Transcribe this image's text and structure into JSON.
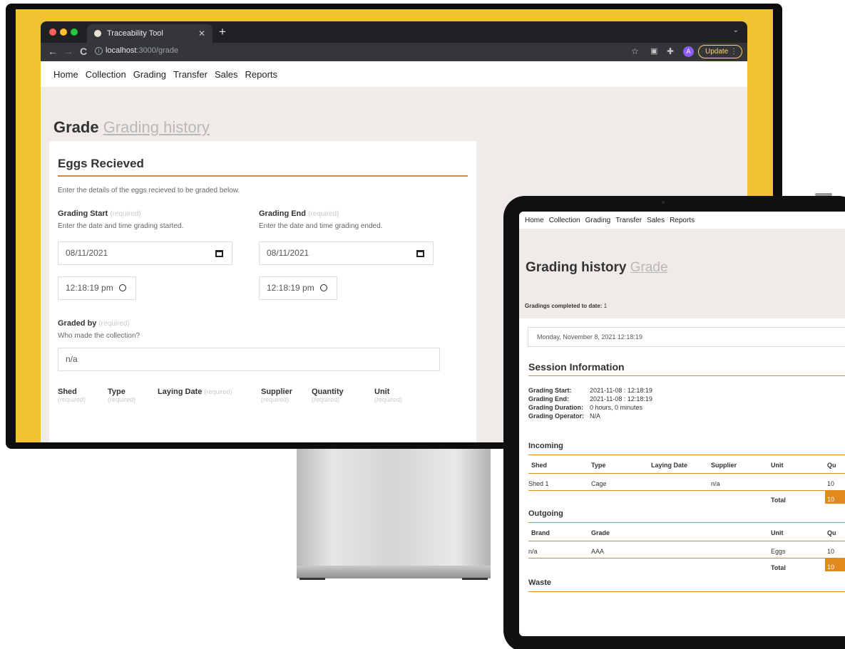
{
  "desktop": {
    "tab_title": "Traceability Tool",
    "url_host": "localhost",
    "url_path": ":3000/grade",
    "update_label": "Update",
    "avatar_initial": "A",
    "nav": [
      "Home",
      "Collection",
      "Grading",
      "Transfer",
      "Sales",
      "Reports"
    ],
    "page_title": "Grade",
    "page_title_link": "Grading history",
    "card": {
      "title": "Eggs Recieved",
      "description": "Enter the details of the eggs recieved to be graded below.",
      "required_tag": "(required)",
      "start_label": "Grading Start",
      "start_hint": "Enter the date and time grading started.",
      "start_date": "08/11/2021",
      "start_time": "12:18:19 pm",
      "end_label": "Grading End",
      "end_hint": "Enter the date and time grading ended.",
      "end_date": "08/11/2021",
      "end_time": "12:18:19 pm",
      "graded_by_label": "Graded by",
      "graded_by_hint": "Who made the collection?",
      "graded_by_value": "n/a",
      "columns": [
        "Shed",
        "Type",
        "Laying Date",
        "Supplier",
        "Quantity",
        "Unit"
      ]
    }
  },
  "tablet": {
    "nav": [
      "Home",
      "Collection",
      "Grading",
      "Transfer",
      "Sales",
      "Reports"
    ],
    "page_title": "Grading history",
    "page_title_link": "Grade",
    "count_label": "Gradings completed to date:",
    "count_value": "1",
    "date_display": "Monday, November 8, 2021 12:18:19",
    "session_title": "Session Information",
    "session": [
      {
        "k": "Grading Start:",
        "v": "2021-11-08 : 12:18:19"
      },
      {
        "k": "Grading End:",
        "v": "2021-11-08 : 12:18:19"
      },
      {
        "k": "Grading Duration:",
        "v": "0 hours, 0 minutes"
      },
      {
        "k": "Grading Operator:",
        "v": "N/A"
      }
    ],
    "incoming": {
      "title": "Incoming",
      "headers": [
        "Shed",
        "Type",
        "Laying Date",
        "Supplier",
        "Unit",
        "Qu"
      ],
      "row": [
        "Shed 1",
        "Cage",
        "",
        "n/a",
        "",
        "10"
      ],
      "total_label": "Total",
      "total_value": "10"
    },
    "outgoing": {
      "title": "Outgoing",
      "headers": [
        "Brand",
        "Grade",
        "Unit",
        "Qu"
      ],
      "row": [
        "n/a",
        "AAA",
        "Eggs",
        "10"
      ],
      "total_label": "Total",
      "total_value": "10"
    },
    "waste_title": "Waste"
  }
}
